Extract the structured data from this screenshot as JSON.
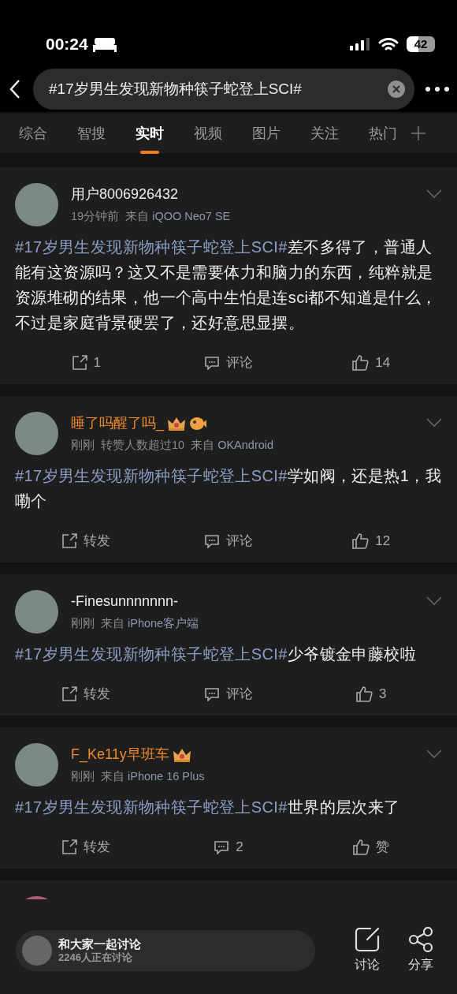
{
  "status_bar": {
    "time": "00:24",
    "battery": "42"
  },
  "search": {
    "value": "#17岁男生发现新物种筷子蛇登上SCI#"
  },
  "tabs": [
    {
      "label": "综合",
      "selected": false
    },
    {
      "label": "智搜",
      "selected": false
    },
    {
      "label": "实时",
      "selected": true
    },
    {
      "label": "视频",
      "selected": false
    },
    {
      "label": "图片",
      "selected": false
    },
    {
      "label": "关注",
      "selected": false
    },
    {
      "label": "热门",
      "selected": false
    }
  ],
  "posts": [
    {
      "name": "用户8006926432",
      "highlighted": false,
      "time": "19分钟前",
      "source_prefix": "来自",
      "source": "iQOO Neo7 SE",
      "hashtag": "#17岁男生发现新物种筷子蛇登上SCI#",
      "body": "差不多得了，普通人能有这资源吗？这又不是需要体力和脑力的东西，纯粹就是资源堆砌的结果，他一个高中生怕是连sci都不知道是什么，不过是家庭背景硬罢了，还好意思显摆。",
      "repost": "1",
      "comment": "评论",
      "like": "14"
    },
    {
      "name": "睡了吗醒了吗_",
      "highlighted": true,
      "badges": [
        {
          "kind": "crown"
        },
        {
          "kind": "fish"
        }
      ],
      "time": "刚刚",
      "extra": "转赞人数超过10",
      "source_prefix": "来自",
      "source": "OKAndroid",
      "hashtag": "#17岁男生发现新物种筷子蛇登上SCI#",
      "body": "学如阀，还是热1，我嘞个",
      "repost": "转发",
      "comment": "评论",
      "like": "12"
    },
    {
      "name": "-Finesunnnnnnn-",
      "highlighted": false,
      "time": "刚刚",
      "source_prefix": "来自",
      "source": "iPhone客户端",
      "hashtag": "#17岁男生发现新物种筷子蛇登上SCI#",
      "body": "少爷镀金申藤校啦",
      "repost": "转发",
      "comment": "评论",
      "like": "3"
    },
    {
      "name": "F_Ke11y早班车",
      "highlighted": true,
      "badges": [
        {
          "kind": "crown"
        }
      ],
      "time": "刚刚",
      "source_prefix": "来自",
      "source": "iPhone 16 Plus",
      "hashtag": "#17岁男生发现新物种筷子蛇登上SCI#",
      "body": "世界的层次来了",
      "repost": "转发",
      "comment": "2",
      "like": "赞"
    }
  ],
  "discussion": {
    "title": "和大家一起讨论",
    "subtitle": "2246人正在讨论"
  },
  "bottom_actions": [
    {
      "kind": "discuss",
      "label": "讨论"
    },
    {
      "kind": "share",
      "label": "分享"
    }
  ]
}
